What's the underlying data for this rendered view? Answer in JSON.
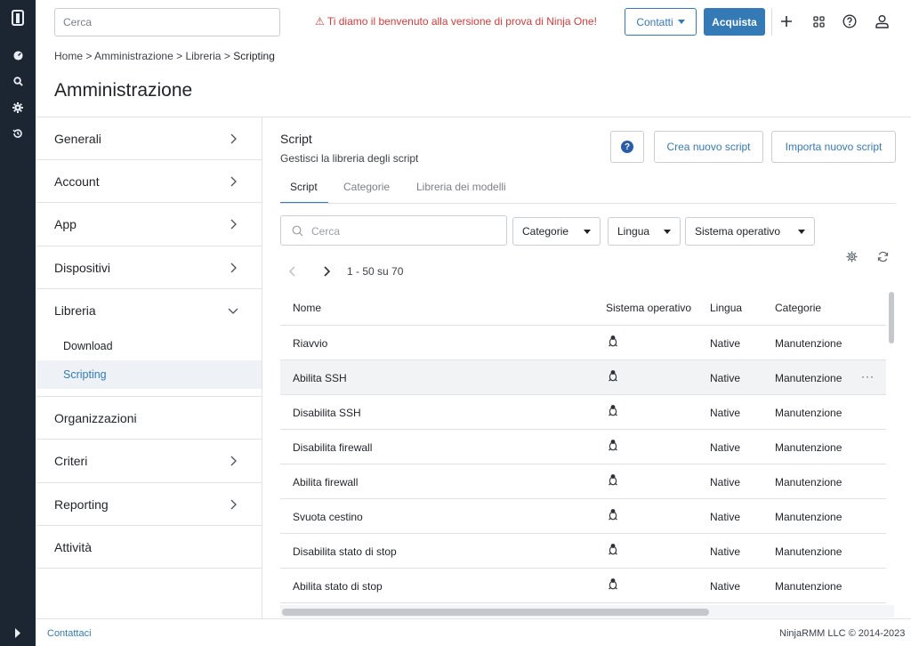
{
  "rail": {
    "icons": [
      "ninja-logo-icon",
      "dashboard-icon",
      "search-icon",
      "settings-icon",
      "history-icon",
      "expand-icon"
    ]
  },
  "topbar": {
    "search_placeholder": "Cerca",
    "welcome": "⚠ Ti diamo il benvenuto alla versione di prova di Ninja One!",
    "contatti_label": "Contatti",
    "acquista_label": "Acquista"
  },
  "breadcrumb": {
    "items": [
      "Home",
      "Amministrazione",
      "Libreria"
    ],
    "current": "Scripting",
    "separator": ">"
  },
  "page_title": "Amministrazione",
  "sidenav": {
    "items": [
      {
        "label": "Generali"
      },
      {
        "label": "Account"
      },
      {
        "label": "App"
      },
      {
        "label": "Dispositivi"
      },
      {
        "label": "Libreria"
      },
      {
        "label": "Organizzazioni"
      },
      {
        "label": "Criteri"
      },
      {
        "label": "Reporting"
      },
      {
        "label": "Attività"
      }
    ],
    "sub_items": [
      {
        "label": "Download"
      },
      {
        "label": "Scripting"
      }
    ]
  },
  "main": {
    "title": "Script",
    "subtitle": "Gestisci la libreria degli script",
    "help_label": "?",
    "create_label": "Crea nuovo script",
    "import_label": "Importa nuovo script",
    "tabs": [
      {
        "label": "Script"
      },
      {
        "label": "Categorie"
      },
      {
        "label": "Libreria dei modelli"
      }
    ],
    "search_placeholder": "Cerca",
    "filters": [
      {
        "label": "Categorie"
      },
      {
        "label": "Lingua"
      },
      {
        "label": "Sistema operativo"
      }
    ],
    "pager_text": "1 - 50 su 70"
  },
  "table": {
    "columns": [
      "Nome",
      "Sistema operativo",
      "Lingua",
      "Categorie"
    ],
    "rows": [
      {
        "name": "Riavvio",
        "os": "linux-icon",
        "lang": "Native",
        "cat": "Manutenzione"
      },
      {
        "name": "Abilita SSH",
        "os": "linux-icon",
        "lang": "Native",
        "cat": "Manutenzione",
        "more": "···"
      },
      {
        "name": "Disabilita SSH",
        "os": "linux-icon",
        "lang": "Native",
        "cat": "Manutenzione"
      },
      {
        "name": "Disabilita firewall",
        "os": "linux-icon",
        "lang": "Native",
        "cat": "Manutenzione"
      },
      {
        "name": "Abilita firewall",
        "os": "linux-icon",
        "lang": "Native",
        "cat": "Manutenzione"
      },
      {
        "name": "Svuota cestino",
        "os": "linux-icon",
        "lang": "Native",
        "cat": "Manutenzione"
      },
      {
        "name": "Disabilita stato di stop",
        "os": "linux-icon",
        "lang": "Native",
        "cat": "Manutenzione"
      },
      {
        "name": "Abilita stato di stop",
        "os": "linux-icon",
        "lang": "Native",
        "cat": "Manutenzione"
      }
    ]
  },
  "footer": {
    "left": "Contattaci",
    "right": "NinjaRMM LLC © 2014-2023"
  },
  "colors": {
    "accent": "#337ab7",
    "rail": "#1c2632",
    "warning": "#d43b3b"
  }
}
